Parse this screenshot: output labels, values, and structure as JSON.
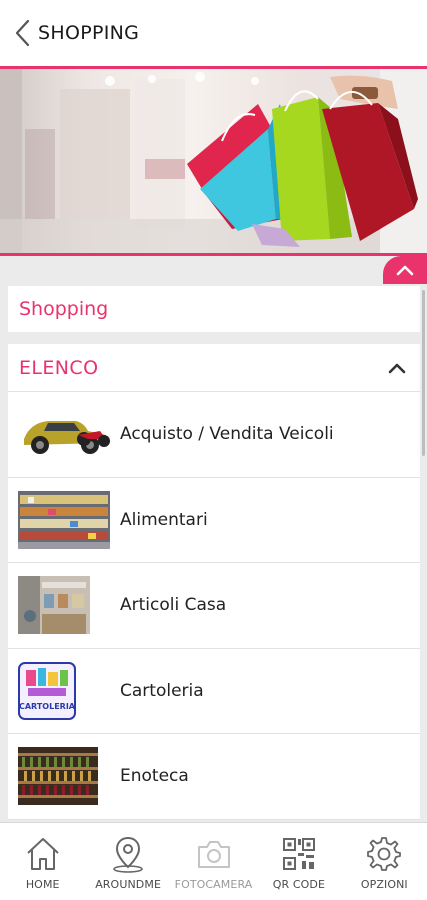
{
  "header": {
    "title": "SHOPPING",
    "back_icon": "chevron-left-icon"
  },
  "hero": {
    "description_icon": "shopping-bags-banner"
  },
  "section": {
    "title": "Shopping"
  },
  "list": {
    "title": "ELENCO",
    "items": [
      {
        "label": "Acquisto / Vendita Veicoli",
        "thumb": "vehicles"
      },
      {
        "label": "Alimentari",
        "thumb": "groceries"
      },
      {
        "label": "Articoli Casa",
        "thumb": "homewares"
      },
      {
        "label": "Cartoleria",
        "thumb": "stationery"
      },
      {
        "label": "Enoteca",
        "thumb": "wine-shop"
      }
    ]
  },
  "tabbar": {
    "items": [
      {
        "label": "HOME",
        "icon": "home-icon"
      },
      {
        "label": "AROUNDME",
        "icon": "location-pin-icon"
      },
      {
        "label": "FOTOCAMERA",
        "icon": "camera-icon"
      },
      {
        "label": "QR CODE",
        "icon": "qr-code-icon"
      },
      {
        "label": "OPZIONI",
        "icon": "gear-icon"
      }
    ]
  },
  "colors": {
    "accent": "#e8336d",
    "background": "#ebebeb"
  }
}
